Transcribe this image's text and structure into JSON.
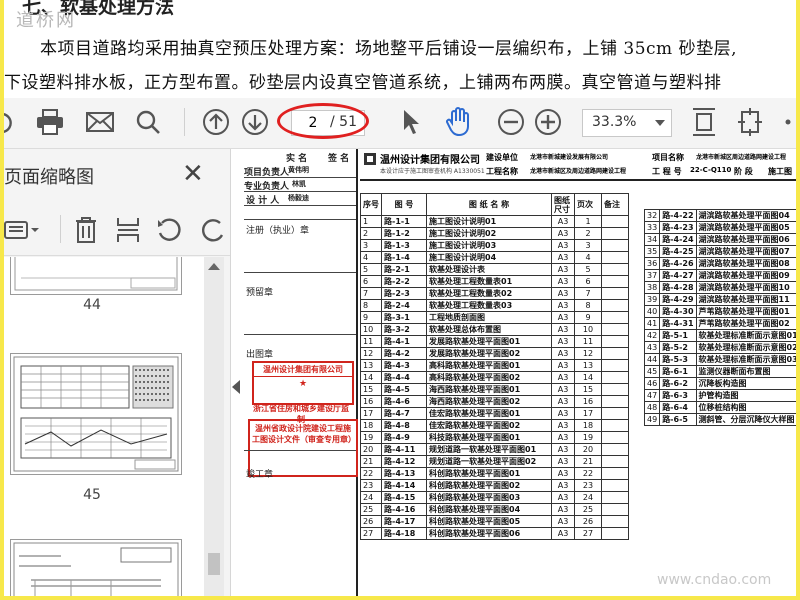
{
  "document_text": {
    "heading": "七、软基处理方法",
    "watermark": "道桥网",
    "line1": "本项目道路均采用抽真空预压处理方案：场地整平后铺设一层编织布，上铺 35cm 砂垫层,",
    "line2": "下设塑料排水板，正方型布置。砂垫层内设真空管道系统，上铺两布两膜。真空管道与塑料排"
  },
  "toolbar": {
    "current_page": "2",
    "total_pages": "/ 51",
    "zoom": "33.3%"
  },
  "thumbnail_panel": {
    "title": "页面缩略图",
    "page_numbers": [
      "44",
      "45"
    ]
  },
  "drawing": {
    "sign_header": [
      "实 名",
      "签 名"
    ],
    "stamp_rows": [
      "项目负责人",
      "专业负责人",
      "设 计 人"
    ],
    "stamp_names": [
      "黄伟明",
      "林凯",
      "杨毅迪"
    ],
    "register_label": "注册（执业）章",
    "reserve_label": "预留章",
    "publish_label": "出图章",
    "work_label": "竣工章",
    "company_stamp": "温州设计集团有限公司",
    "company_stamp_sub": "浙江省住房和城乡建设厅监制",
    "review_stamp": "温州省政设计院建设工程施工图设计文件（审查专用章）",
    "company": "温州设计集团有限公司",
    "company_note": "本设计应于施工图审查机构 A1330051",
    "build_unit_label": "建设单位",
    "build_unit": "龙港市新城建设发展有限公司",
    "project_label": "工程名称",
    "project": "龙港市新城区及周边道路网建设工程",
    "project_no_label": "项目名称",
    "project_no": "龙港市新城区周边道路网建设工程",
    "job_label": "工 程 号",
    "job": "22-C-Q110",
    "stage_label": "阶 段",
    "stage": "施工图",
    "columns": [
      "序号",
      "图 号",
      "图 纸 名 称",
      "图纸尺寸",
      "页次",
      "备注"
    ],
    "rows": [
      [
        "1",
        "路-1-1",
        "施工图设计说明01",
        "A3",
        "1"
      ],
      [
        "2",
        "路-1-2",
        "施工图设计说明02",
        "A3",
        "2"
      ],
      [
        "3",
        "路-1-3",
        "施工图设计说明03",
        "A3",
        "3"
      ],
      [
        "4",
        "路-1-4",
        "施工图设计说明04",
        "A3",
        "4"
      ],
      [
        "5",
        "路-2-1",
        "软基处理设计表",
        "A3",
        "5"
      ],
      [
        "6",
        "路-2-2",
        "软基处理工程数量表01",
        "A3",
        "6"
      ],
      [
        "7",
        "路-2-3",
        "软基处理工程数量表02",
        "A3",
        "7"
      ],
      [
        "8",
        "路-2-4",
        "软基处理工程数量表03",
        "A3",
        "8"
      ],
      [
        "9",
        "路-3-1",
        "工程地质剖面图",
        "A3",
        "9"
      ],
      [
        "10",
        "路-3-2",
        "软基处理总体布置图",
        "A3",
        "10"
      ],
      [
        "11",
        "路-4-1",
        "发展路软基处理平面图01",
        "A3",
        "11"
      ],
      [
        "12",
        "路-4-2",
        "发展路软基处理平面图02",
        "A3",
        "12"
      ],
      [
        "13",
        "路-4-3",
        "高科路软基处理平面图01",
        "A3",
        "13"
      ],
      [
        "14",
        "路-4-4",
        "高科路软基处理平面图02",
        "A3",
        "14"
      ],
      [
        "15",
        "路-4-5",
        "海西路软基处理平面图01",
        "A3",
        "15"
      ],
      [
        "16",
        "路-4-6",
        "海西路软基处理平面图02",
        "A3",
        "16"
      ],
      [
        "17",
        "路-4-7",
        "佳宏路软基处理平面图01",
        "A3",
        "17"
      ],
      [
        "18",
        "路-4-8",
        "佳宏路软基处理平面图02",
        "A3",
        "18"
      ],
      [
        "19",
        "路-4-9",
        "科技路软基处理平面图01",
        "A3",
        "19"
      ],
      [
        "20",
        "路-4-11",
        "规划道路一软基处理平面图01",
        "A3",
        "20"
      ],
      [
        "21",
        "路-4-12",
        "规划道路一软基处理平面图02",
        "A3",
        "21"
      ],
      [
        "22",
        "路-4-13",
        "科创路软基处理平面图01",
        "A3",
        "22"
      ],
      [
        "23",
        "路-4-14",
        "科创路软基处理平面图02",
        "A3",
        "23"
      ],
      [
        "24",
        "路-4-15",
        "科创路软基处理平面图03",
        "A3",
        "24"
      ],
      [
        "25",
        "路-4-16",
        "科创路软基处理平面图04",
        "A3",
        "25"
      ],
      [
        "26",
        "路-4-17",
        "科创路软基处理平面图05",
        "A3",
        "26"
      ],
      [
        "27",
        "路-4-18",
        "科创路软基处理平面图06",
        "A3",
        "27"
      ]
    ],
    "right_rows": [
      [
        "32",
        "路-4-22",
        "湖滨路软基处理平面图04"
      ],
      [
        "33",
        "路-4-23",
        "湖滨路软基处理平面图05"
      ],
      [
        "34",
        "路-4-24",
        "湖滨路软基处理平面图06"
      ],
      [
        "35",
        "路-4-25",
        "湖滨路软基处理平面图07"
      ],
      [
        "36",
        "路-4-26",
        "湖滨路软基处理平面图08"
      ],
      [
        "37",
        "路-4-27",
        "湖滨路软基处理平面图09"
      ],
      [
        "38",
        "路-4-28",
        "湖滨路软基处理平面图10"
      ],
      [
        "39",
        "路-4-29",
        "湖滨路软基处理平面图11"
      ],
      [
        "40",
        "路-4-30",
        "芦苇路软基处理平面图01"
      ],
      [
        "41",
        "路-4-31",
        "芦苇路软基处理平面图02"
      ],
      [
        "42",
        "路-5-1",
        "软基处理标准断面示意图01"
      ],
      [
        "43",
        "路-5-2",
        "软基处理标准断面示意图02"
      ],
      [
        "44",
        "路-5-3",
        "软基处理标准断面示意图03"
      ],
      [
        "45",
        "路-6-1",
        "监测仪器断面布置图"
      ],
      [
        "46",
        "路-6-2",
        "沉降板构造图"
      ],
      [
        "47",
        "路-6-3",
        "护管构造图"
      ],
      [
        "48",
        "路-6-4",
        "位移桩结构图"
      ],
      [
        "49",
        "路-6-5",
        "测斜管、分层沉降仪大样图"
      ]
    ]
  },
  "site_watermark": "www.cndao.com",
  "colors": {
    "border": "#f7e84a",
    "stamp_red": "#d0241c",
    "annot_red": "#e02020"
  },
  "icons": [
    "undo-icon",
    "print-icon",
    "mail-icon",
    "search-icon",
    "arrow-up-icon",
    "arrow-down-icon",
    "cursor-icon",
    "hand-icon",
    "zoom-out-icon",
    "zoom-in-icon",
    "fit-page-icon",
    "fit-width-icon",
    "more-icon"
  ]
}
